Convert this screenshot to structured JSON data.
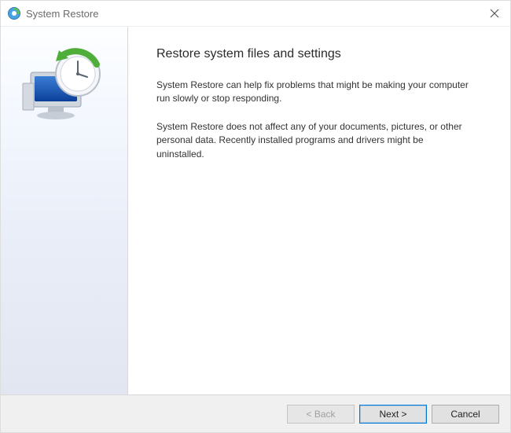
{
  "window": {
    "title": "System Restore"
  },
  "main": {
    "heading": "Restore system files and settings",
    "para1": "System Restore can help fix problems that might be making your computer run slowly or stop responding.",
    "para2": "System Restore does not affect any of your documents, pictures, or other personal data. Recently installed programs and drivers might be uninstalled."
  },
  "footer": {
    "back_label": "< Back",
    "next_label": "Next >",
    "cancel_label": "Cancel"
  }
}
